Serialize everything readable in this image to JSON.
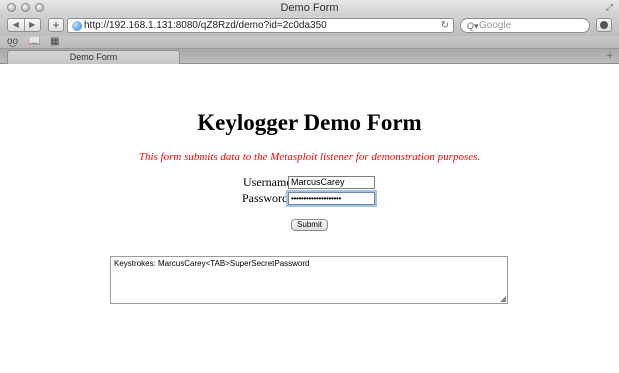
{
  "window": {
    "title": "Demo Form"
  },
  "toolbar": {
    "back_glyph": "◀",
    "forward_glyph": "▶",
    "new_tab_glyph": "+",
    "url": "http://192.168.1.131:8080/qZ8Rzd/demo?id=2c0da350",
    "reload_glyph": "↻",
    "search_placeholder": "Google",
    "search_glyph": "Q▾"
  },
  "bookmarks": {
    "reading_glyph": "o͜o",
    "book_glyph": "📖",
    "grid_glyph": "▦"
  },
  "tabs": [
    {
      "label": "Demo Form",
      "active": true
    }
  ],
  "tabbar": {
    "new_tab_glyph": "+"
  },
  "page": {
    "heading": "Keylogger Demo Form",
    "subtitle": "This form submits data to the Metasploit listener for demonstration purposes.",
    "username_label": "Username:",
    "username_value": "MarcusCarey",
    "password_label": "Password:",
    "password_value": "••••••••••••••••••••",
    "submit_label": "Submit",
    "keystrokes_text": "Keystrokes: MarcusCarey<TAB>SuperSecretPassword"
  },
  "colors": {
    "subtitle": "#ff0000",
    "focus_ring": "#a9c2e0"
  }
}
